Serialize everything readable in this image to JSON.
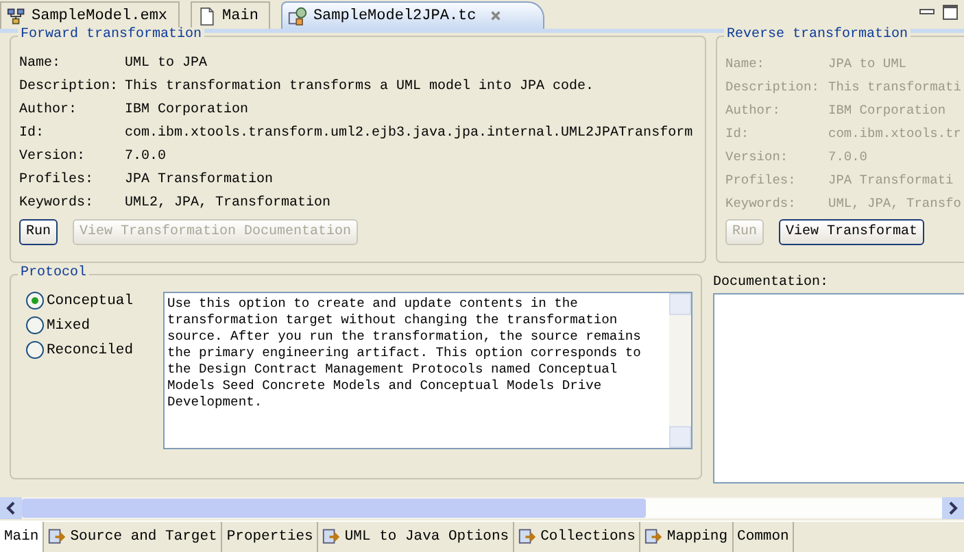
{
  "editor_tabs": [
    {
      "label": "SampleModel.emx",
      "kind": "model",
      "selected": false,
      "closable": false
    },
    {
      "label": "Main",
      "kind": "file",
      "selected": false,
      "closable": false
    },
    {
      "label": "SampleModel2JPA.tc",
      "kind": "transform",
      "selected": true,
      "closable": true
    }
  ],
  "forward": {
    "title": "Forward transformation",
    "disabled": false,
    "fields": [
      {
        "label": "Name:",
        "value": "UML to JPA"
      },
      {
        "label": "Description:",
        "value": "This transformation transforms a UML model into JPA code."
      },
      {
        "label": "Author:",
        "value": "IBM Corporation"
      },
      {
        "label": "Id:",
        "value": "com.ibm.xtools.transform.uml2.ejb3.java.jpa.internal.UML2JPATransform"
      },
      {
        "label": "Version:",
        "value": "7.0.0"
      },
      {
        "label": "Profiles:",
        "value": "JPA Transformation"
      },
      {
        "label": "Keywords:",
        "value": "UML2, JPA, Transformation"
      }
    ],
    "buttons": [
      {
        "label": "Run",
        "disabled": false
      },
      {
        "label": "View Transformation Documentation",
        "disabled": true
      }
    ]
  },
  "reverse": {
    "title": "Reverse transformation",
    "disabled": true,
    "fields": [
      {
        "label": "Name:",
        "value": "JPA to UML"
      },
      {
        "label": "Description:",
        "value": "This transformati"
      },
      {
        "label": "Author:",
        "value": "IBM Corporation"
      },
      {
        "label": "Id:",
        "value": "com.ibm.xtools.tr"
      },
      {
        "label": "Version:",
        "value": "7.0.0"
      },
      {
        "label": "Profiles:",
        "value": "JPA Transformati"
      },
      {
        "label": "Keywords:",
        "value": "UML, JPA, Transfo"
      }
    ],
    "buttons": [
      {
        "label": "Run",
        "disabled": true
      },
      {
        "label": "View Transformat",
        "disabled": false
      }
    ]
  },
  "protocol": {
    "title": "Protocol",
    "options": [
      {
        "label": "Conceptual",
        "selected": true
      },
      {
        "label": "Mixed",
        "selected": false
      },
      {
        "label": "Reconciled",
        "selected": false
      }
    ],
    "description": "Use this option to create and update contents in the transformation target without changing the transformation source. After you run the transformation, the source remains the primary engineering artifact. This option corresponds to the Design Contract Management Protocols named Conceptual Models Seed Concrete Models and Conceptual Models Drive Development."
  },
  "documentation": {
    "label": "Documentation:"
  },
  "bottom_tabs": [
    {
      "label": "Main",
      "selected": true,
      "has_icon": false
    },
    {
      "label": "Source and Target",
      "selected": false,
      "has_icon": true
    },
    {
      "label": "Properties",
      "selected": false,
      "has_icon": false
    },
    {
      "label": "UML to Java Options",
      "selected": false,
      "has_icon": true
    },
    {
      "label": "Collections",
      "selected": false,
      "has_icon": true
    },
    {
      "label": "Mapping",
      "selected": false,
      "has_icon": true
    },
    {
      "label": "Common",
      "selected": false,
      "has_icon": false
    }
  ]
}
